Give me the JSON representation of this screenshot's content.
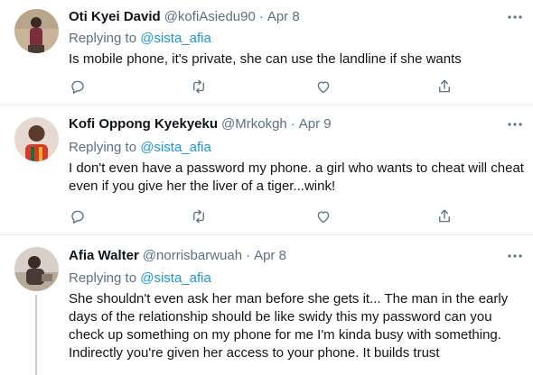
{
  "tweets": [
    {
      "display_name": "Oti Kyei David",
      "handle": "@kofiAsiedu90",
      "separator": "·",
      "date": "Apr 8",
      "replying_prefix": "Replying to",
      "replying_to": "@sista_afia",
      "text_lines": [
        "Is mobile phone,  it's private,  she can use the landline if she wants"
      ],
      "avatar_colors": {
        "bg": "#c9b49a",
        "fg": "#7a2f3a"
      }
    },
    {
      "display_name": "Kofi Oppong Kyekyeku",
      "handle": "@Mrkokgh",
      "separator": "·",
      "date": "Apr 9",
      "replying_prefix": "Replying to",
      "replying_to": "@sista_afia",
      "text_lines": [
        "I don't even have a password my phone. a girl who wants to cheat will cheat",
        "even if you give her the liver of a tiger...wink!"
      ],
      "avatar_colors": {
        "bg": "#e7d9d0",
        "fg": "#d43b2a"
      }
    },
    {
      "display_name": "Afia Walter",
      "handle": "@norrisbarwuah",
      "separator": "·",
      "date": "Apr 8",
      "replying_prefix": "Replying to",
      "replying_to": "@sista_afia",
      "text_lines": [
        "She shouldn't even ask her man before she gets it... The man in the early",
        "days of the relationship should be like swidy this my password can you",
        "check up something on my phone for me I'm kinda busy with something.",
        "Indirectly you're given her access to your phone. It builds trust"
      ],
      "avatar_colors": {
        "bg": "#d8d0c8",
        "fg": "#4a3a35"
      }
    }
  ],
  "icons": {
    "more": "more-icon",
    "reply": "reply-icon",
    "retweet": "retweet-icon",
    "like": "like-icon",
    "share": "share-icon"
  },
  "colors": {
    "text_primary": "#0f1419",
    "text_secondary": "#5b7083",
    "mention": "#1b95e0",
    "divider": "#e6ecf0",
    "thread_line": "#c4cfd6"
  }
}
